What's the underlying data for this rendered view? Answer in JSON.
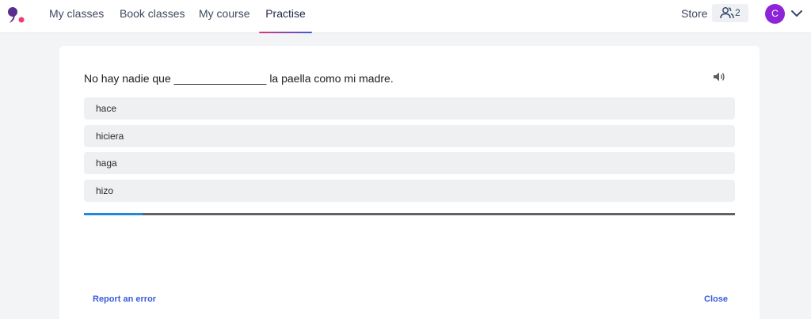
{
  "nav": {
    "items": [
      {
        "label": "My classes",
        "active": false
      },
      {
        "label": "Book classes",
        "active": false
      },
      {
        "label": "My course",
        "active": false
      },
      {
        "label": "Practise",
        "active": true
      }
    ],
    "store_label": "Store",
    "friends_count": "2",
    "avatar_initial": "C",
    "icons": {
      "logo": "brand-logo-icon",
      "friends": "people-icon",
      "menu": "chevron-down-icon"
    }
  },
  "exercise": {
    "question": "No hay nadie que _______________ la paella como mi madre.",
    "audio_icon": "speaker-icon",
    "options": [
      "hace",
      "hiciera",
      "haga",
      "hizo"
    ],
    "progress": 0.09
  },
  "footer": {
    "report_label": "Report an error",
    "close_label": "Close"
  },
  "colors": {
    "accent_blue": "#3b5bdb",
    "avatar_purple": "#8e24d8",
    "progress_blue": "#1e88e5",
    "tab_gradient_start": "#e0357a",
    "tab_gradient_end": "#3b5bdb",
    "logo_purple": "#5b2d8f",
    "logo_pink": "#ef3e6f"
  }
}
